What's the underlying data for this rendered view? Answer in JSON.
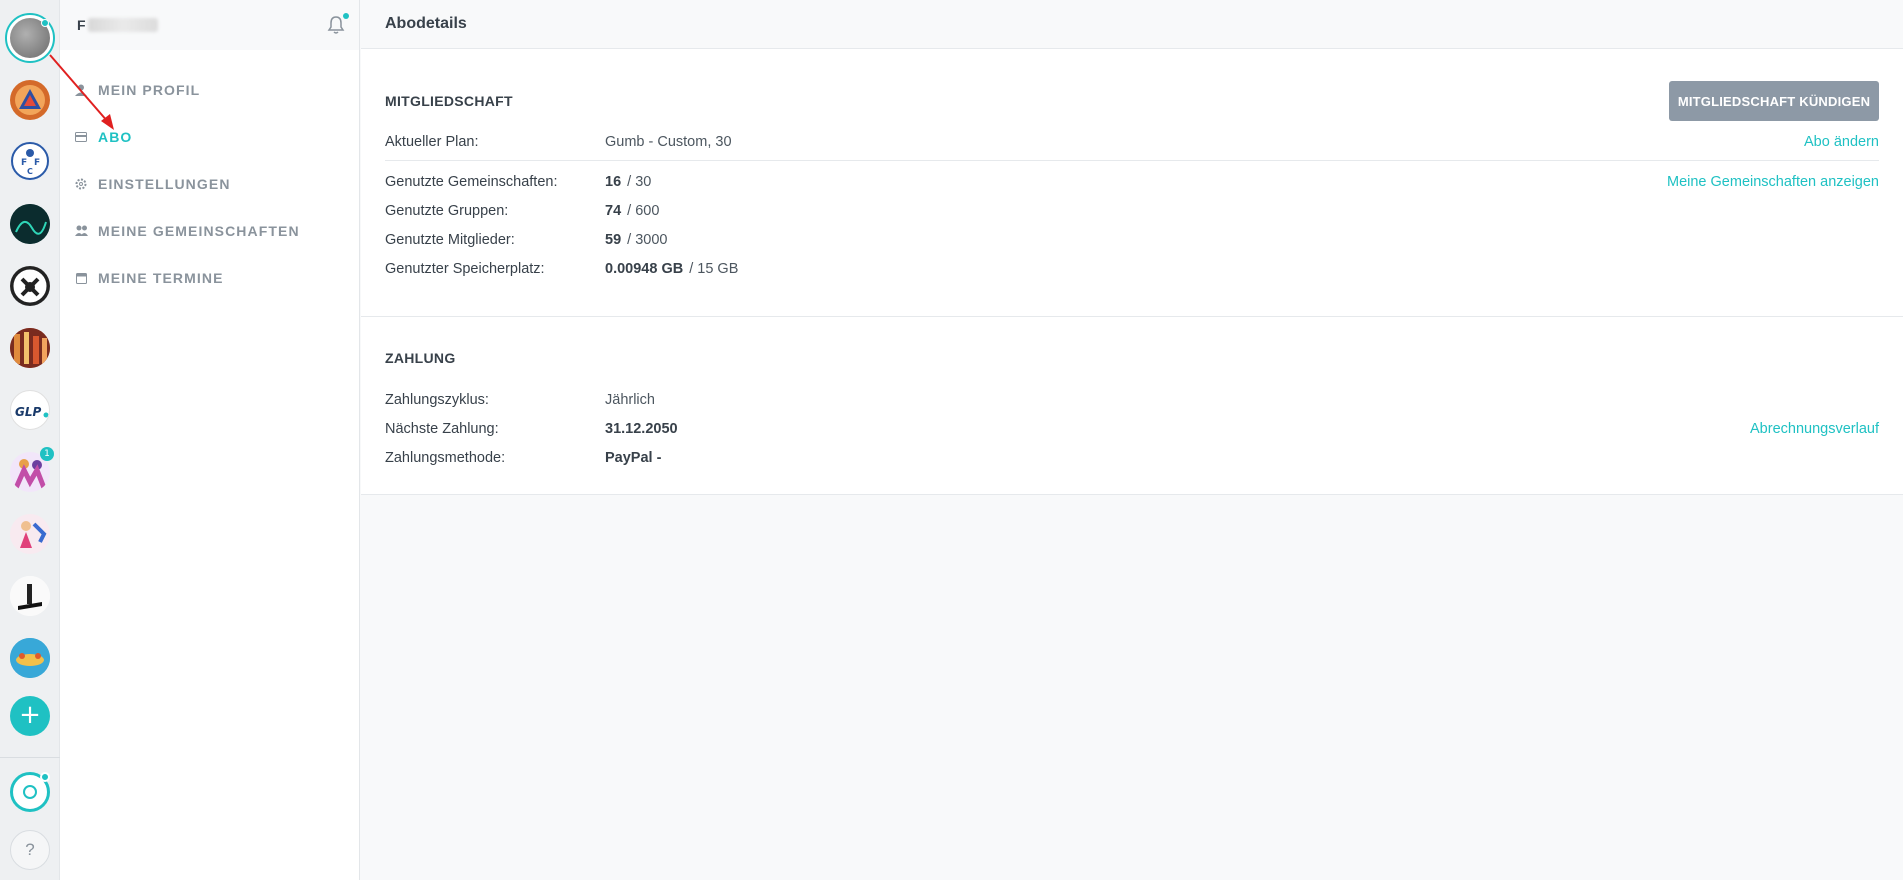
{
  "rail": {
    "badge_count": "1",
    "add_label": "+",
    "help_label": "?",
    "avatar_colors": [
      "#8a8a8a",
      "#d46a2a",
      "#e9eef5",
      "#0d3b3b",
      "#2b2b2b",
      "#b5442d",
      "#ffffff",
      "#c29be0",
      "#e8c3c3",
      "#1e1e1e",
      "#2e9ec9"
    ],
    "glp_label": "GLP."
  },
  "menu": {
    "user_initial": "F",
    "items": [
      {
        "label": "MEIN PROFIL",
        "icon": "user-icon"
      },
      {
        "label": "ABO",
        "icon": "card-icon"
      },
      {
        "label": "EINSTELLUNGEN",
        "icon": "gear-icon"
      },
      {
        "label": "MEINE GEMEINSCHAFTEN",
        "icon": "users-icon"
      },
      {
        "label": "MEINE TERMINE",
        "icon": "calendar-icon"
      }
    ]
  },
  "main": {
    "title": "Abodetails",
    "membership": {
      "title": "MITGLIEDSCHAFT",
      "cancel_label": "MITGLIEDSCHAFT KÜNDIGEN",
      "plan_label": "Aktueller Plan:",
      "plan_value": "Gumb - Custom, 30",
      "change_link": "Abo ändern",
      "communities_label": "Genutzte Gemeinschaften:",
      "communities_used": "16",
      "communities_total": "/ 30",
      "show_communities_link": "Meine Gemeinschaften anzeigen",
      "groups_label": "Genutzte Gruppen:",
      "groups_used": "74",
      "groups_total": "/ 600",
      "members_label": "Genutzte Mitglieder:",
      "members_used": "59",
      "members_total": "/ 3000",
      "storage_label": "Genutzter Speicherplatz:",
      "storage_used": "0.00948 GB",
      "storage_total": "/ 15 GB"
    },
    "payment": {
      "title": "ZAHLUNG",
      "cycle_label": "Zahlungszyklus:",
      "cycle_value": "Jährlich",
      "next_label": "Nächste Zahlung:",
      "next_value": "31.12.2050",
      "history_link": "Abrechnungsverlauf",
      "method_label": "Zahlungsmethode:",
      "method_value": "PayPal -"
    }
  }
}
